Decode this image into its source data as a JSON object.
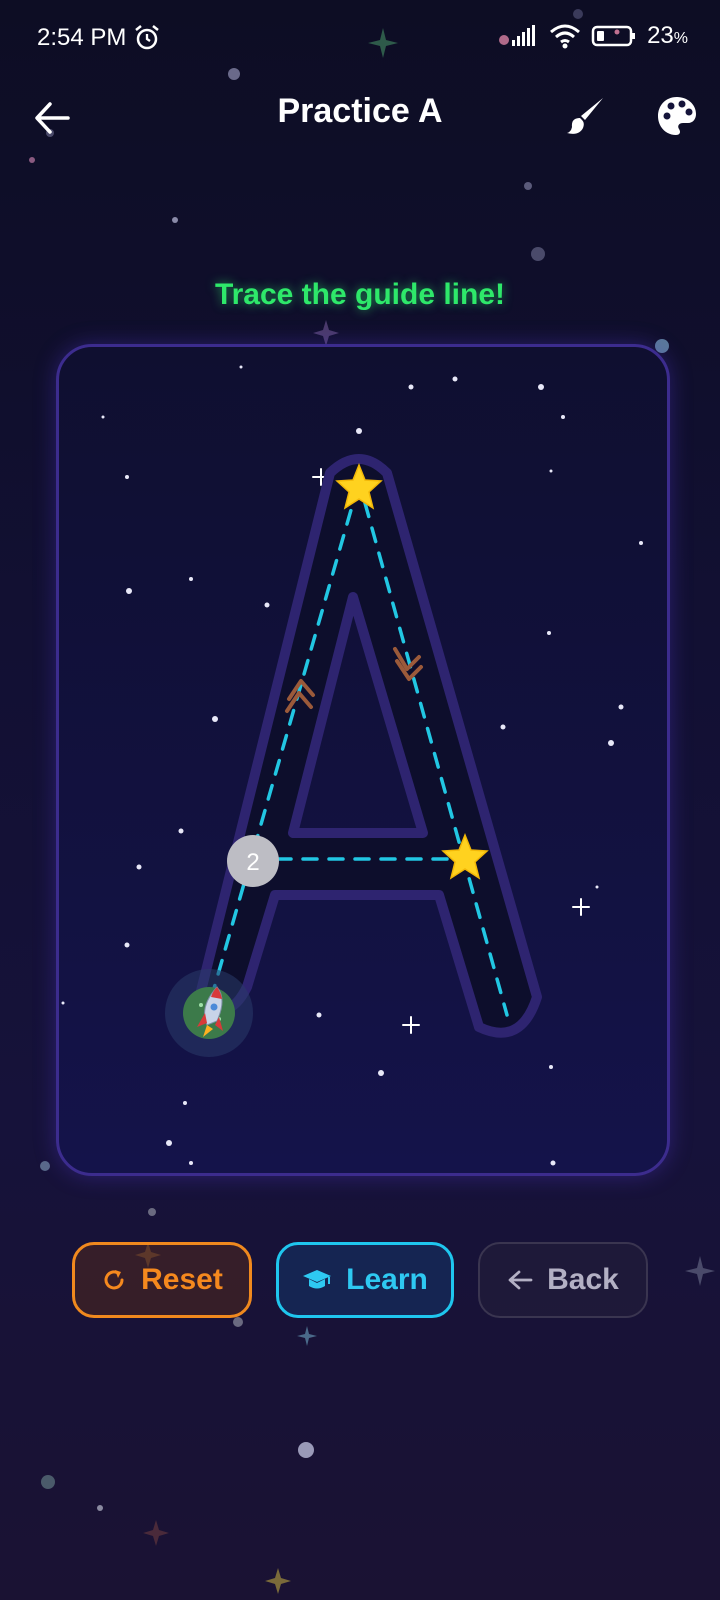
{
  "status_bar": {
    "time": "2:54 PM",
    "battery": "23",
    "battery_unit": "%",
    "icons": [
      "alarm-icon",
      "signal-icon",
      "wifi-icon",
      "battery-icon"
    ]
  },
  "app_bar": {
    "title": "Practice A",
    "icons": [
      "back-arrow-icon",
      "brush-icon",
      "palette-icon"
    ]
  },
  "instruction": "Trace the guide line!",
  "tracing": {
    "letter": "A",
    "stroke_number": "2",
    "guide_color": "#22c7e3",
    "icons": [
      "star-icon",
      "rocket-icon",
      "direction-chevron-icon"
    ]
  },
  "buttons": {
    "reset": "Reset",
    "learn": "Learn",
    "back": "Back"
  },
  "colors": {
    "instruction": "#2ee86a",
    "reset": "#f0891e",
    "learn": "#1fc6ee",
    "back": "#b3b0c4"
  }
}
